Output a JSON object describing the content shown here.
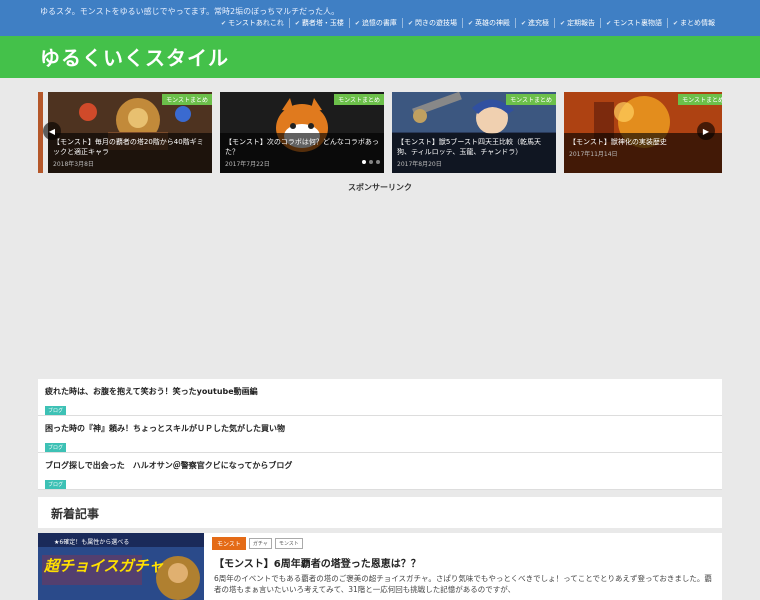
{
  "topbar": {
    "description": "ゆるスタ。モンストをゆるい感じでやってます。常時2垢のぼっちマルチだった人。",
    "nav": [
      {
        "label": "モンストあれこれ"
      },
      {
        "label": "覇者塔・玉楼"
      },
      {
        "label": "追憶の書庫"
      },
      {
        "label": "閃きの遊技場"
      },
      {
        "label": "英雄の神殿"
      },
      {
        "label": "進究極"
      },
      {
        "label": "定期報告"
      },
      {
        "label": "モンスト裏物語"
      },
      {
        "label": "まとめ情報"
      }
    ]
  },
  "header": {
    "title": "ゆるくいくスタイル"
  },
  "carousel": {
    "slides": [
      {
        "tag": "モンストまとめ",
        "title": "【モンスト】毎月の覇者の塔20階から40階ギミックと適正キャラ",
        "date": "2018年3月8日"
      },
      {
        "tag": "モンストまとめ",
        "title": "【モンスト】次のコラボは何？どんなコラボあった？",
        "date": "2017年7月22日"
      },
      {
        "tag": "モンストまとめ",
        "title": "【モンスト】獣5ブースト四天王比較（乾馬天狗、ティルロッテ、玉龍、チャンドラ）",
        "date": "2017年8月20日"
      },
      {
        "tag": "モンストまとめ",
        "title": "【モンスト】獣神化の実装歴史",
        "date": "2017年11月14日"
      }
    ],
    "colors": {
      "tag": "#6cc04a"
    }
  },
  "sponsor": {
    "label": "スポンサーリンク"
  },
  "list": [
    {
      "title": "疲れた時は、お腹を抱えて笑おう！笑ったyoutube動画編",
      "tag": "ブログ"
    },
    {
      "title": "困った時の『神』頼み！ちょっとスキルがＵＰした気がした買い物",
      "tag": "ブログ"
    },
    {
      "title": "ブログ探しで出会った　ハルオサン＠警察官クビになってからブログ",
      "tag": "ブログ"
    }
  ],
  "section": {
    "heading": "新着記事"
  },
  "article": {
    "category": "モンスト",
    "tags": [
      "ガチャ",
      "モンスト"
    ],
    "title": "【モンスト】6周年覇者の塔登った恩恵は？？",
    "excerpt": "6周年のイベントでもある覇者の塔のご褒美の超チョイスガチャ。さぱり気味でもやっとくべきでしょ！ってことでとりあえず登っておきました。覇者の塔もまぁ言いたいいろ考えてみて、31階と一応何回も挑戦した記憶があるのですが、",
    "thumb_text": "超チョイスガチャ",
    "thumb_sub": "★6確定！も属性から選べる"
  },
  "colors": {
    "topbar": "#3f7fc4",
    "header": "#44c14a",
    "list_tag": "#3dc1b5",
    "article_category": "#e46b17"
  },
  "icons": {
    "nav_tick": "check-icon",
    "prev": "chevron-left-icon",
    "next": "chevron-right-icon"
  }
}
